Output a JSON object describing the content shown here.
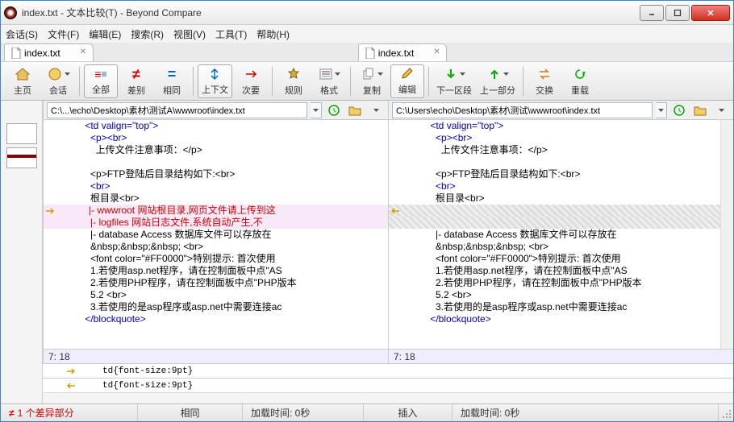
{
  "title": "index.txt - 文本比较(T) - Beyond Compare",
  "menu": {
    "session": "会话(S)",
    "file": "文件(F)",
    "edit": "编辑(E)",
    "search": "搜索(R)",
    "view": "视图(V)",
    "tools": "工具(T)",
    "help": "帮助(H)"
  },
  "tabs": {
    "left": "index.txt",
    "right": "index.txt"
  },
  "toolbar": {
    "home": "主页",
    "sessions": "会话",
    "all": "全部",
    "diff": "差别",
    "same": "相同",
    "context": "上下文",
    "minor": "次要",
    "rules": "规则",
    "format": "格式",
    "copy": "复制",
    "edit": "编辑",
    "next": "下一区段",
    "prev": "上一部分",
    "swap": "交换",
    "reload": "重载"
  },
  "paths": {
    "left": "C:\\...\\echo\\Desktop\\素材\\测试A\\wwwroot\\index.txt",
    "right": "C:\\Users\\echo\\Desktop\\素材\\测试\\wwwroot\\index.txt"
  },
  "code": {
    "l1": "          <td valign=\"top\">",
    "l2": "            <p><br>",
    "l3": "              上传文件注意事项：</p>",
    "l4": "",
    "l5": "            <p>FTP登陆后目录结构如下:<br>",
    "l6": "            <br>",
    "l7": "            根目录<br>",
    "d1": "            |- wwwroot 网站根目录,网页文件请上传到这",
    "d2": "            |- logfiles 网站日志文件,系统自动产生,不",
    "l8": "            |- database Access 数据库文件可以存放在",
    "l9": "            &nbsp;&nbsp;&nbsp; <br>",
    "l10": "            <font color=\"#FF0000\">特别提示: 首次使用",
    "l11": "            1.若使用asp.net程序，请在控制面板中点\"AS",
    "l12": "            2.若使用PHP程序，请在控制面板中点\"PHP版本",
    "l13": "            5.2 <br>",
    "l14": "            3.若使用的是asp程序或asp.net中需要连接ac",
    "l15": "          </blockquote>"
  },
  "pos": "7: 18",
  "bottom_text": "td{font-size:9pt}",
  "status": {
    "icon": "≠",
    "diff": "1 个差异部分",
    "same": "相同",
    "load": "加载时间: 0秒",
    "insert": "插入",
    "load2": "加载时间: 0秒"
  }
}
